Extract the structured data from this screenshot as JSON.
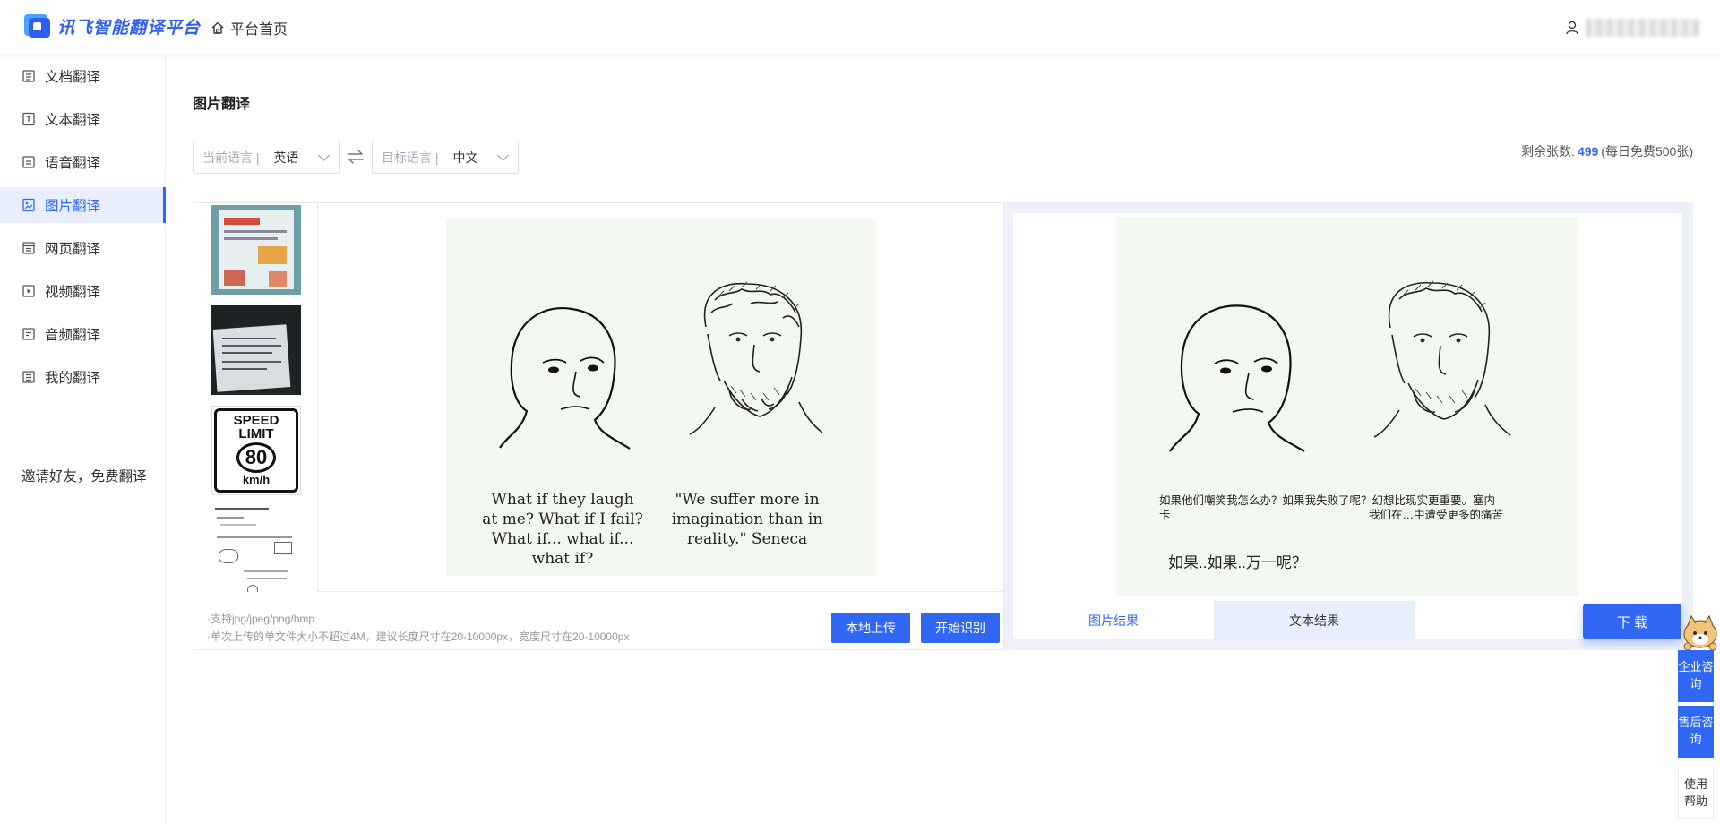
{
  "header": {
    "logo_text": "讯飞智能翻译平台",
    "home_label": "平台首页"
  },
  "sidebar": {
    "items": [
      {
        "label": "文档翻译",
        "icon": "document-icon"
      },
      {
        "label": "文本翻译",
        "icon": "text-icon"
      },
      {
        "label": "语音翻译",
        "icon": "voice-icon"
      },
      {
        "label": "图片翻译",
        "icon": "image-icon",
        "active": true
      },
      {
        "label": "网页翻译",
        "icon": "webpage-icon"
      },
      {
        "label": "视频翻译",
        "icon": "video-icon"
      },
      {
        "label": "音频翻译",
        "icon": "audio-icon"
      },
      {
        "label": "我的翻译",
        "icon": "my-translation-icon"
      }
    ],
    "invite": "邀请好友，免费翻译"
  },
  "main": {
    "title": "图片翻译",
    "source_lang": {
      "label": "当前语言 |",
      "value": "英语"
    },
    "target_lang": {
      "label": "目标语言 |",
      "value": "中文"
    },
    "quota": {
      "label": "剩余张数:",
      "count": "499",
      "note": "(每日免费500张)"
    }
  },
  "thumbs": {
    "speed_sign": {
      "line1": "SPEED",
      "line2": "LIMIT",
      "number": "80",
      "unit": "km/h"
    }
  },
  "source_image": {
    "caption_left": "What if they laugh at me? What if I fail? What if... what if... what if?",
    "caption_right": "\"We suffer more in imagination than in reality.\" Seneca"
  },
  "result_image": {
    "line1": "如果他们嘲笑我怎么办？如果我失败了呢？幻想比现实更重要。塞内",
    "line2_left": "卡",
    "line2_right": "我们在…中遭受更多的痛苦",
    "line3": "如果..如果..万一呢？"
  },
  "upload": {
    "hint1": "·支持jpg/jpeg/png/bmp",
    "hint2": "·单次上传的单文件大小不超过4M，建议长度尺寸在20-10000px，宽度尺寸在20-10000px",
    "local_upload": "本地上传",
    "start": "开始识别"
  },
  "result_tabs": {
    "image_result": "图片结果",
    "text_result": "文本结果",
    "download": "下 载"
  },
  "float": {
    "enterprise": "企业咨询",
    "aftersale": "售后咨询",
    "help": "使用帮助"
  },
  "colors": {
    "accent": "#3068f5",
    "active_bg": "#e9eefe"
  }
}
